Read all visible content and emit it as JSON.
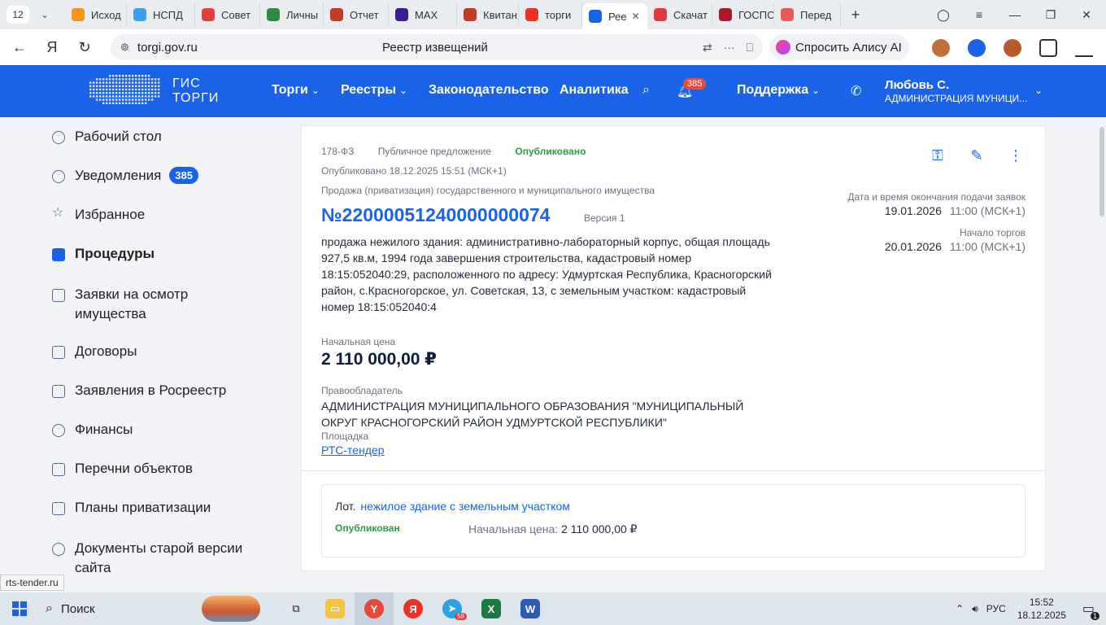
{
  "browser": {
    "tab_count": "12",
    "tabs": [
      {
        "label": "Исход",
        "color": "#f7941d"
      },
      {
        "label": "НСПД",
        "color": "#3aa0e8"
      },
      {
        "label": "Совет",
        "color": "#e04141"
      },
      {
        "label": "Личны",
        "color": "#2b8a3e"
      },
      {
        "label": "Отчет",
        "color": "#c0392b"
      },
      {
        "label": "MAX",
        "color": "#3a1d8f"
      },
      {
        "label": "Квитан",
        "color": "#c0392b"
      },
      {
        "label": "торги",
        "color": "#ef3124"
      },
      {
        "label": "Рее",
        "color": "#1a62e8",
        "active": true
      },
      {
        "label": "Скачат",
        "color": "#e23b3b"
      },
      {
        "label": "ГОСПС",
        "color": "#a8192e"
      },
      {
        "label": "Перед",
        "color": "#e65a5a"
      }
    ],
    "url": "torgi.gov.ru",
    "page_title": "Реестр извещений",
    "alice_label": "Спросить Алису AI"
  },
  "header": {
    "logo_line1": "ГИС",
    "logo_line2": "ТОРГИ",
    "menu": [
      {
        "label": "Торги",
        "dropdown": true
      },
      {
        "label": "Реестры",
        "dropdown": true
      },
      {
        "label": "Законодательство",
        "dropdown": false
      },
      {
        "label": "Аналитика",
        "dropdown": false
      }
    ],
    "notifications_count": "385",
    "support_label": "Поддержка",
    "user_name": "Любовь С.",
    "user_org": "АДМИНИСТРАЦИЯ МУНИЦИ..."
  },
  "sidebar": {
    "items": [
      {
        "label": "Рабочий стол"
      },
      {
        "label": "Уведомления",
        "badge": "385"
      },
      {
        "label": "Избранное"
      },
      {
        "label": "Процедуры",
        "active": true
      },
      {
        "label": "Заявки на осмотр имущества"
      },
      {
        "label": "Договоры"
      },
      {
        "label": "Заявления в Росреестр"
      },
      {
        "label": "Финансы"
      },
      {
        "label": "Перечни объектов"
      },
      {
        "label": "Планы приватизации"
      },
      {
        "label": "Документы старой версии сайта"
      }
    ]
  },
  "notice": {
    "law": "178-ФЗ",
    "type": "Публичное предложение",
    "status": "Опубликовано",
    "published": "Опубликовано 18.12.2025 15:51 (МСК+1)",
    "category": "Продажа (приватизация) государственного и муниципального имущества",
    "number": "№22000051240000000074",
    "version": "Версия 1",
    "description": "продажа нежилого здания: административно-лабораторный корпус, общая площадь 927,5 кв.м, 1994 года завершения строительства, кадастровый номер 18:15:052040:29, расположенного по адресу: Удмуртская Республика, Красногорский район, с.Красногорское, ул. Советская, 13, с земельным участком: кадастровый номер 18:15:052040:4",
    "price_label": "Начальная цена",
    "price": "2 110 000,00 ₽",
    "owner_label": "Правообладатель",
    "owner": "АДМИНИСТРАЦИЯ МУНИЦИПАЛЬНОГО ОБРАЗОВАНИЯ \"МУНИЦИПАЛЬНЫЙ ОКРУГ КРАСНОГОРСКИЙ РАЙОН УДМУРТСКОЙ РЕСПУБЛИКИ\"",
    "platform_label": "Площадка",
    "platform": "РТС-тендер",
    "deadline_label": "Дата и время окончания подачи заявок",
    "deadline_date": "19.01.2026",
    "deadline_time": "11:00 (МСК+1)",
    "start_label": "Начало торгов",
    "start_date": "20.01.2026",
    "start_time": "11:00 (МСК+1)"
  },
  "lot": {
    "prefix": "Лот.",
    "title": "нежилое здание с земельным участком",
    "status": "Опубликован",
    "price_label": "Начальная цена:",
    "price": "2 110 000,00 ₽"
  },
  "status_tooltip": "rts-tender.ru",
  "taskbar": {
    "search_label": "Поиск",
    "telegram_badge": "58",
    "lang": "РУС",
    "time": "15:52",
    "date": "18.12.2025",
    "notif_count": "1"
  }
}
